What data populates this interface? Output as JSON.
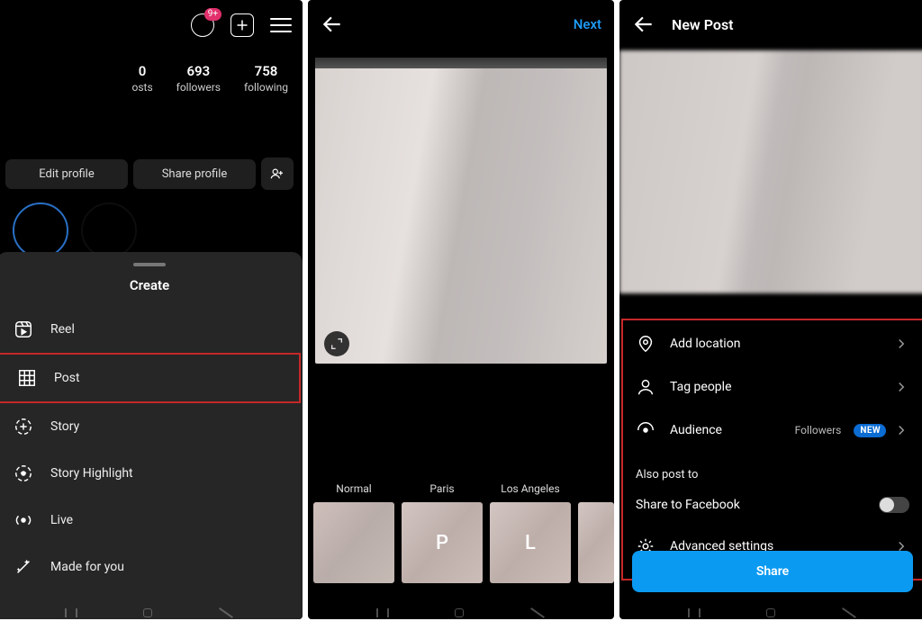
{
  "screen1": {
    "badge": "9+",
    "stats": {
      "posts": {
        "count": "0",
        "label": "osts"
      },
      "followers": {
        "count": "693",
        "label": "followers"
      },
      "following": {
        "count": "758",
        "label": "following"
      }
    },
    "buttons": {
      "edit": "Edit profile",
      "share": "Share profile"
    },
    "sheet": {
      "title": "Create",
      "items": [
        {
          "label": "Reel"
        },
        {
          "label": "Post"
        },
        {
          "label": "Story"
        },
        {
          "label": "Story Highlight"
        },
        {
          "label": "Live"
        },
        {
          "label": "Made for you"
        }
      ]
    }
  },
  "screen2": {
    "next": "Next",
    "filters": [
      {
        "label": "Normal",
        "letter": ""
      },
      {
        "label": "Paris",
        "letter": "P"
      },
      {
        "label": "Los Angeles",
        "letter": "L"
      },
      {
        "label": "",
        "letter": ""
      }
    ]
  },
  "screen3": {
    "title": "New Post",
    "options": {
      "location": "Add location",
      "tag": "Tag people",
      "audience": "Audience",
      "audience_value": "Followers",
      "audience_badge": "NEW",
      "also_title": "Also post to",
      "facebook": "Share to Facebook",
      "advanced": "Advanced settings"
    },
    "share": "Share"
  }
}
